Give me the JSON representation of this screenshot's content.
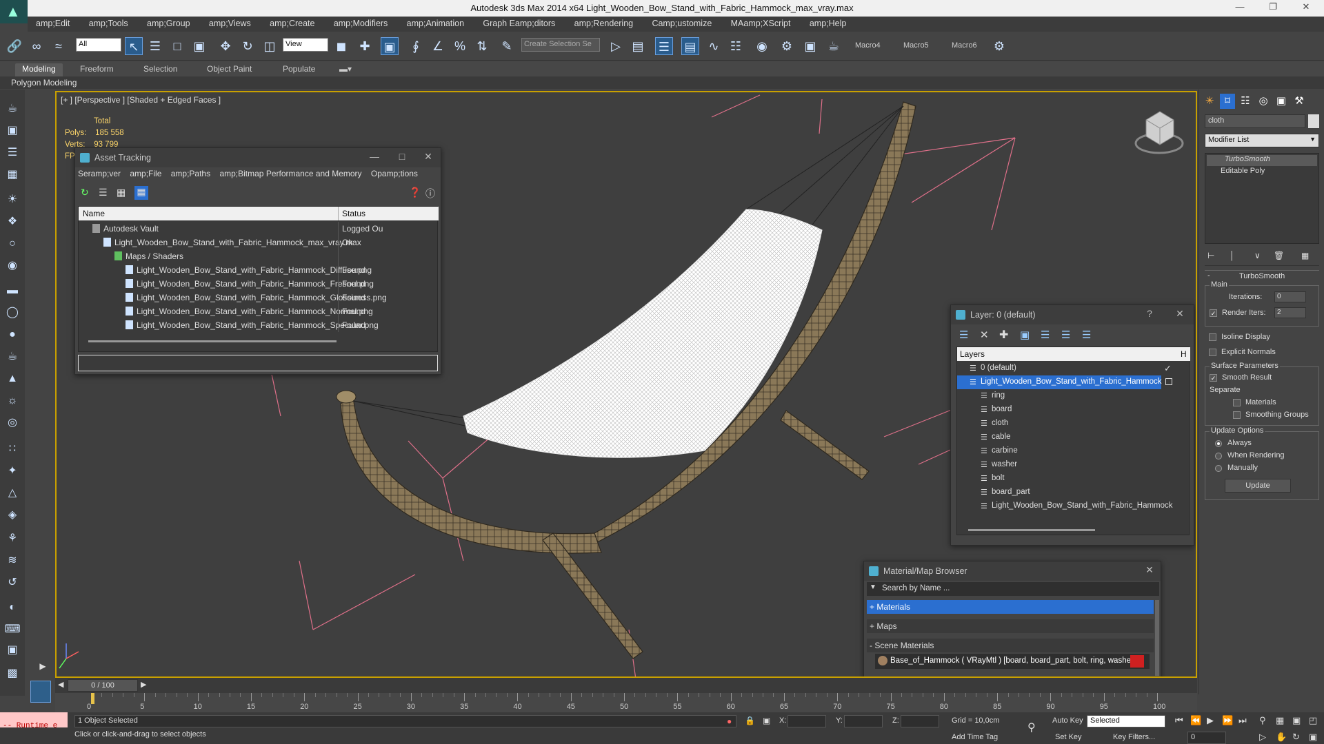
{
  "window": {
    "title": "Autodesk 3ds Max  2014 x64     Light_Wooden_Bow_Stand_with_Fabric_Hammock_max_vray.max"
  },
  "menu": [
    "amp;Edit",
    "amp;Tools",
    "amp;Group",
    "amp;Views",
    "amp;Create",
    "amp;Modifiers",
    "amp;Animation",
    "Graph Eamp;ditors",
    "amp;Rendering",
    "Camp;ustomize",
    "MAamp;XScript",
    "amp;Help"
  ],
  "toolbar": {
    "filter_select": "All",
    "view_select": "View",
    "selection_set_placeholder": "Create Selection Se",
    "macros": [
      "Macro4",
      "Macro5",
      "Macro6"
    ]
  },
  "ribbon": {
    "tabs": [
      "Modeling",
      "Freeform",
      "Selection",
      "Object Paint",
      "Populate"
    ],
    "active_tab": "Modeling",
    "sub_label": "Polygon Modeling"
  },
  "viewport": {
    "label": "[+ ] [Perspective ] [Shaded + Edged Faces ]",
    "stats": {
      "header": "Total",
      "polys_label": "Polys:",
      "polys_value": "185 558",
      "verts_label": "Verts:",
      "verts_value": "93 799",
      "fps_label": "FPS:"
    }
  },
  "asset_tracking": {
    "title": "Asset Tracking",
    "menu": [
      "Seramp;ver",
      "amp;File",
      "amp;Paths",
      "amp;Bitmap Performance and Memory",
      "Opamp;tions"
    ],
    "columns": [
      "Name",
      "Status"
    ],
    "rows": [
      {
        "name": "Autodesk Vault",
        "status": "Logged Ou",
        "indent": 0
      },
      {
        "name": "Light_Wooden_Bow_Stand_with_Fabric_Hammock_max_vray.max",
        "status": "Ok",
        "indent": 1
      },
      {
        "name": "Maps / Shaders",
        "status": "",
        "indent": 2
      },
      {
        "name": "Light_Wooden_Bow_Stand_with_Fabric_Hammock_Diffuse.png",
        "status": "Found",
        "indent": 3
      },
      {
        "name": "Light_Wooden_Bow_Stand_with_Fabric_Hammock_Fresnel.png",
        "status": "Found",
        "indent": 3
      },
      {
        "name": "Light_Wooden_Bow_Stand_with_Fabric_Hammock_Glossiness.png",
        "status": "Found",
        "indent": 3
      },
      {
        "name": "Light_Wooden_Bow_Stand_with_Fabric_Hammock_Normal.png",
        "status": "Found",
        "indent": 3
      },
      {
        "name": "Light_Wooden_Bow_Stand_with_Fabric_Hammock_Specular.png",
        "status": "Found",
        "indent": 3
      }
    ]
  },
  "layer_dialog": {
    "title": "Layer: 0 (default)",
    "help": "?",
    "header": "Layers",
    "header_right": "H",
    "layers": [
      "0 (default)",
      "Light_Wooden_Bow_Stand_with_Fabric_Hammock",
      "ring",
      "board",
      "cloth",
      "cable",
      "carbine",
      "washer",
      "bolt",
      "board_part",
      "Light_Wooden_Bow_Stand_with_Fabric_Hammock"
    ],
    "selected_index": 1
  },
  "material_browser": {
    "title": "Material/Map Browser",
    "search_placeholder": "Search by Name ...",
    "sections": [
      "+ Materials",
      "+ Maps",
      "- Scene Materials"
    ],
    "scene_material": "Base_of_Hammock  ( VRayMtl )  [board, board_part, bolt, ring, washer]"
  },
  "command_panel": {
    "object_name": "cloth",
    "modifier_list": "Modifier List",
    "stack": [
      "TurboSmooth",
      "Editable Poly"
    ],
    "rollout_title": "TurboSmooth",
    "main_label": "Main",
    "iterations_label": "Iterations:",
    "iterations_value": "0",
    "render_iters_label": "Render Iters:",
    "render_iters_value": "2",
    "isoline": "Isoline Display",
    "explicit_normals": "Explicit Normals",
    "surface_params": "Surface Parameters",
    "smooth_result": "Smooth Result",
    "separate": "Separate",
    "materials": "Materials",
    "smoothing_groups": "Smoothing Groups",
    "update_options": "Update Options",
    "always": "Always",
    "when_rendering": "When Rendering",
    "manually": "Manually",
    "update_btn": "Update"
  },
  "timeline": {
    "frame": "0 / 100",
    "ticks": [
      "0",
      "5",
      "10",
      "15",
      "20",
      "25",
      "30",
      "35",
      "40",
      "45",
      "50",
      "55",
      "60",
      "65",
      "70",
      "75",
      "80",
      "85",
      "90",
      "95",
      "100"
    ]
  },
  "status": {
    "script": "-- Runtime e",
    "selected": "1 Object Selected",
    "prompt": "Click or click-and-drag to select objects",
    "x_label": "X:",
    "y_label": "Y:",
    "z_label": "Z:",
    "grid": "Grid = 10,0cm",
    "auto_key": "Auto Key",
    "selected_dropdown": "Selected",
    "set_key": "Set Key",
    "key_filters": "Key Filters...",
    "add_time_tag": "Add Time Tag",
    "frame_field": "0"
  },
  "colors": {
    "accent": "#2b6fd0",
    "viewport_border": "#c8a000",
    "stats_text": "#ffd86b",
    "runtime_bg": "#ffc8c8"
  }
}
